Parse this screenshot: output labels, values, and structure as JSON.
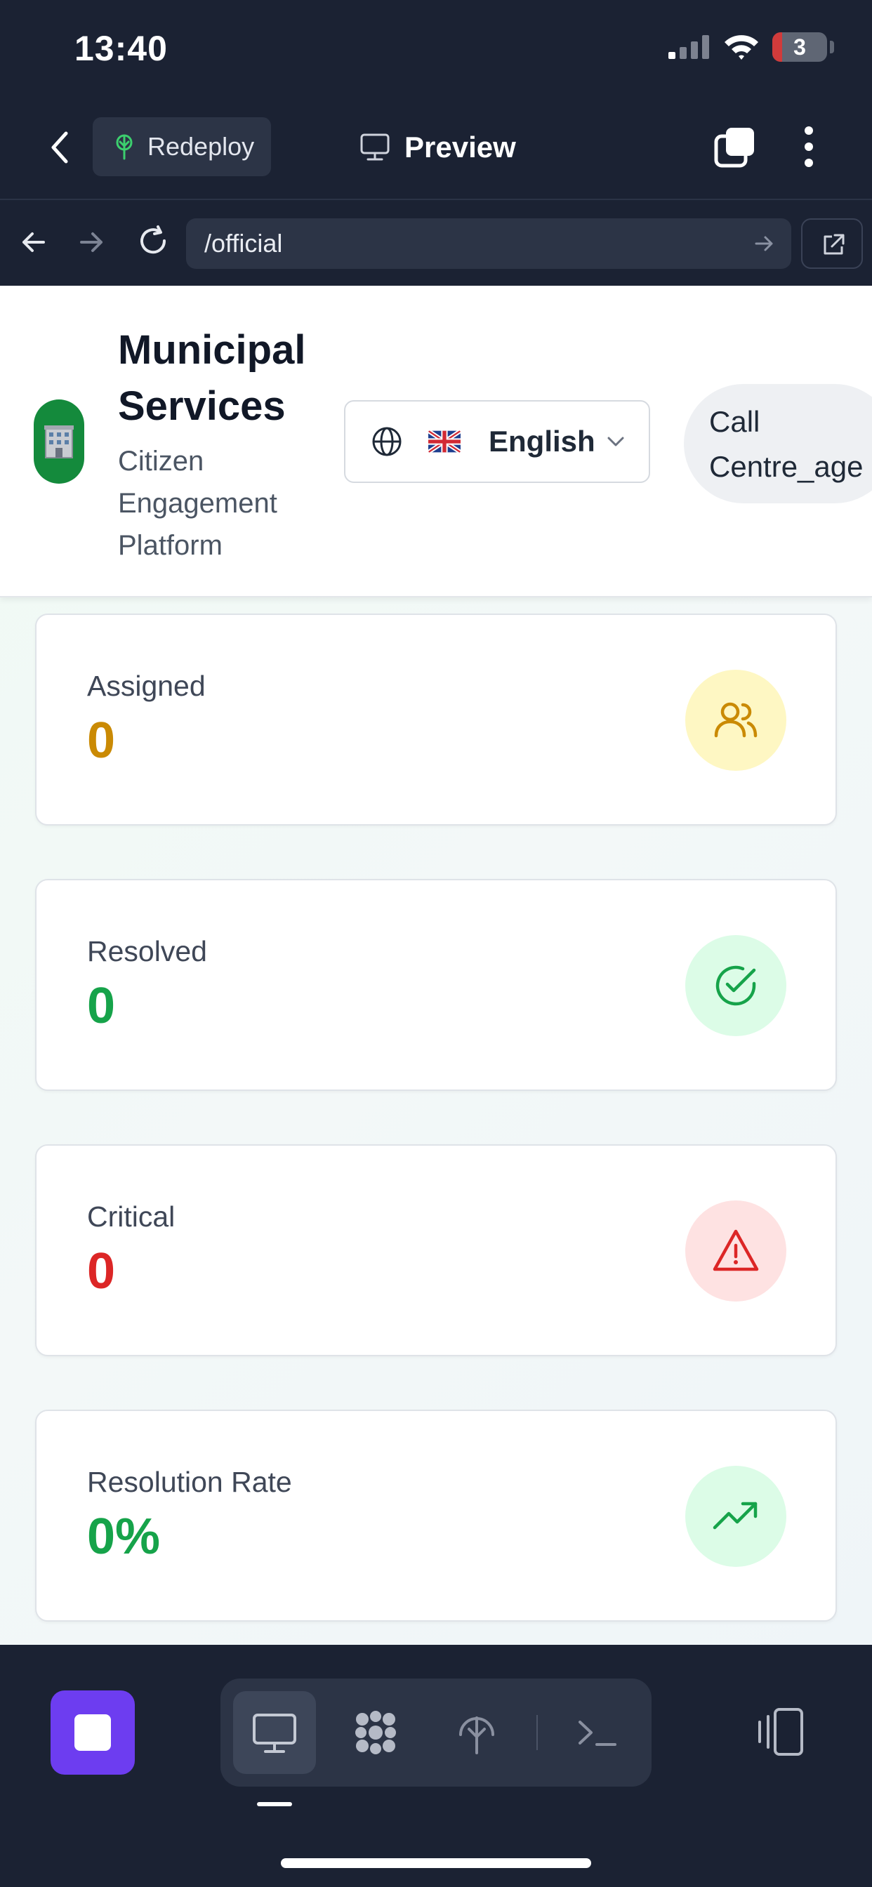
{
  "status_bar": {
    "time": "13:40",
    "battery": "3"
  },
  "toolbar": {
    "redeploy_label": "Redeploy",
    "preview_label": "Preview"
  },
  "browser": {
    "url": "/official"
  },
  "site": {
    "title": "Municipal Services",
    "subtitle": "Citizen Engagement Platform",
    "logo_emoji": "🏢",
    "language": "English",
    "agent_line1": "Call",
    "agent_line2": "Centre_age"
  },
  "stats": [
    {
      "label": "Assigned",
      "value": "0",
      "color": "#ca8a04",
      "icon": "users-icon",
      "icon_bg": "#fef7c3"
    },
    {
      "label": "Resolved",
      "value": "0",
      "color": "#16a34a",
      "icon": "check-circle-icon",
      "icon_bg": "#dcfce7"
    },
    {
      "label": "Critical",
      "value": "0",
      "color": "#dc2626",
      "icon": "alert-triangle-icon",
      "icon_bg": "#fee2e2"
    },
    {
      "label": "Resolution Rate",
      "value": "0%",
      "color": "#16a34a",
      "icon": "trending-up-icon",
      "icon_bg": "#dcfce7"
    }
  ],
  "bottom_bar": {
    "mode_prompt": ">_"
  }
}
